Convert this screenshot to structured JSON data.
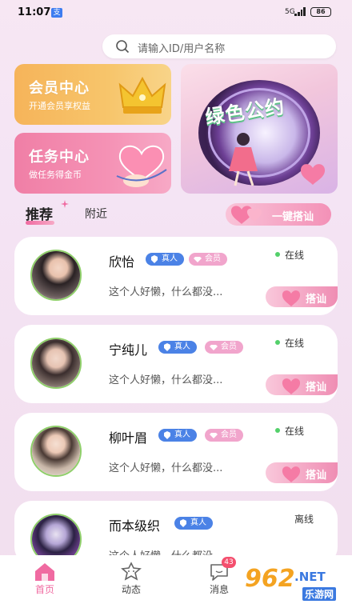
{
  "status_bar": {
    "time": "11:07",
    "app_icon_text": "支",
    "network": "5G",
    "battery": "86"
  },
  "search": {
    "placeholder": "请输入ID/用户名称"
  },
  "banners": {
    "vip": {
      "title": "会员中心",
      "subtitle": "开通会员享权益"
    },
    "task": {
      "title": "任务中心",
      "subtitle": "做任务得金币"
    },
    "pact": {
      "title": "绿色公约"
    }
  },
  "tabs": {
    "recommend": "推荐",
    "nearby": "附近"
  },
  "one_key_button": "一键搭讪",
  "users": [
    {
      "name": "欣怡",
      "real": "真人",
      "vip": "会员",
      "status": "在线",
      "signature": "这个人好懒，什么都没...",
      "chat": "搭讪"
    },
    {
      "name": "宁纯儿",
      "real": "真人",
      "vip": "会员",
      "status": "在线",
      "signature": "这个人好懒，什么都没...",
      "chat": "搭讪"
    },
    {
      "name": "柳叶眉",
      "real": "真人",
      "vip": "会员",
      "status": "在线",
      "signature": "这个人好懒，什么都没...",
      "chat": "搭讪"
    },
    {
      "name": "而本级织",
      "real": "真人",
      "status": "离线",
      "signature": "这个人好懒，什么都没..."
    }
  ],
  "nav": {
    "items": [
      {
        "label": "首页",
        "icon": "home-icon"
      },
      {
        "label": "动态",
        "icon": "moment-icon"
      },
      {
        "label": "消息",
        "icon": "message-icon",
        "badge": "43"
      }
    ]
  },
  "watermark": {
    "main": "962",
    "suffix": ".NET",
    "site": "乐游网"
  },
  "colors": {
    "accent": "#f06aa1",
    "real_badge": "#4b82e6",
    "vip_badge": "#f1a5cc",
    "online": "#53d06a"
  }
}
